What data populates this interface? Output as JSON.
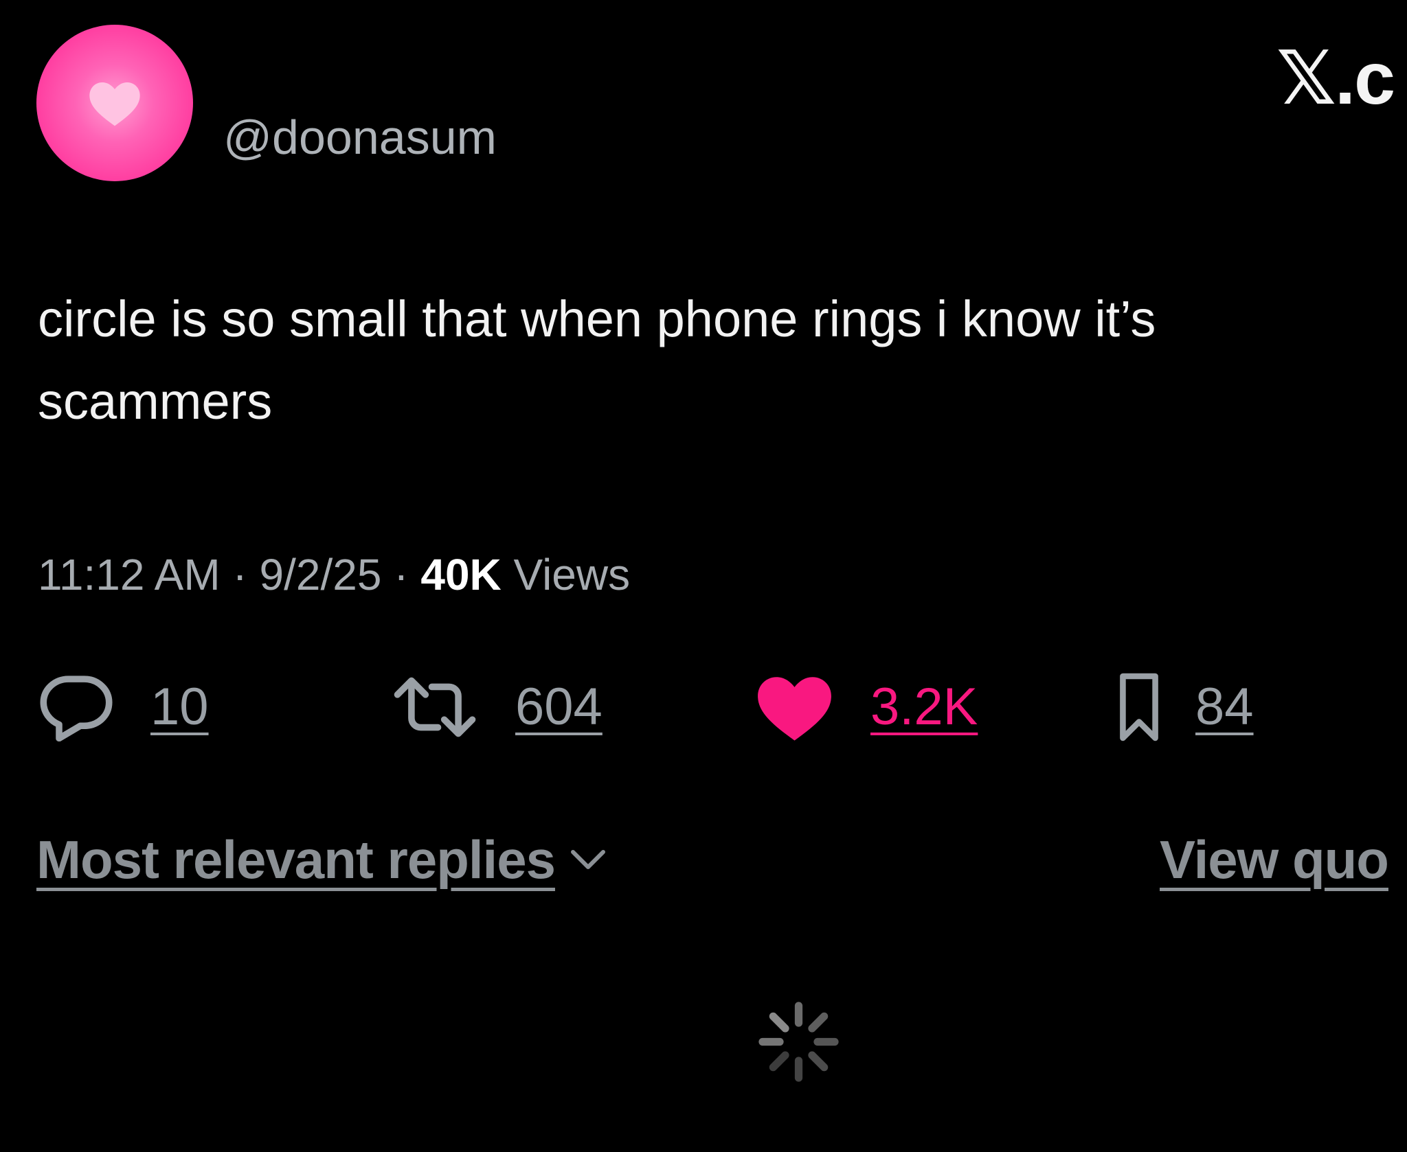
{
  "author": {
    "handle": "@doonasum",
    "avatar_icon": "heart-icon"
  },
  "brand": {
    "glyph": "𝕏",
    "suffix": ".c"
  },
  "tweet": {
    "text": "circle is so small that when phone rings i know it’s\nscammers"
  },
  "meta": {
    "time": "11:12 AM",
    "separator": "·",
    "date": "9/2/25",
    "views_count": "40K",
    "views_label": "Views"
  },
  "actions": {
    "replies": "10",
    "reposts": "604",
    "likes": "3.2K",
    "bookmarks": "84"
  },
  "replies_section": {
    "sort_label": "Most relevant replies",
    "view_quotes_label": "View quo"
  },
  "colors": {
    "background": "#000000",
    "like_accent": "#f91880",
    "avatar_pink": "#ff3fa1",
    "muted_text": "#9aa0a6"
  }
}
